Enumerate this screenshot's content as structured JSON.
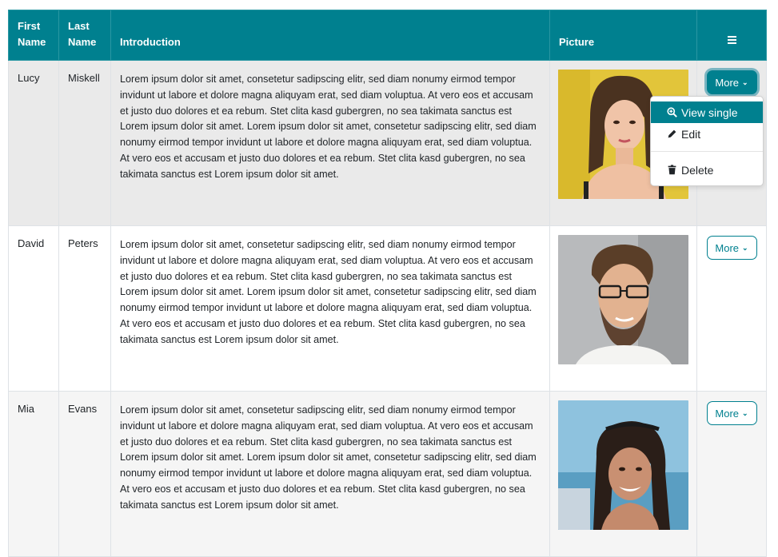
{
  "table": {
    "headers": {
      "first_name": "First Name",
      "last_name": "Last Name",
      "introduction": "Introduction",
      "picture": "Picture",
      "menu_icon": "hamburger-menu-icon"
    },
    "rows": [
      {
        "first_name": "Lucy",
        "last_name": "Miskell",
        "introduction": "Lorem ipsum dolor sit amet, consetetur sadipscing elitr, sed diam nonumy eirmod tempor invidunt ut labore et dolore magna aliquyam erat, sed diam voluptua. At vero eos et accusam et justo duo dolores et ea rebum. Stet clita kasd gubergren, no sea takimata sanctus est Lorem ipsum dolor sit amet. Lorem ipsum dolor sit amet, consetetur sadipscing elitr, sed diam nonumy eirmod tempor invidunt ut labore et dolore magna aliquyam erat, sed diam voluptua. At vero eos et accusam et justo duo dolores et ea rebum. Stet clita kasd gubergren, no sea takimata sanctus est Lorem ipsum dolor sit amet.",
        "picture": "woman-portrait-yellow-background",
        "more_label": "More"
      },
      {
        "first_name": "David",
        "last_name": "Peters",
        "introduction": "Lorem ipsum dolor sit amet, consetetur sadipscing elitr, sed diam nonumy eirmod tempor invidunt ut labore et dolore magna aliquyam erat, sed diam voluptua. At vero eos et accusam et justo duo dolores et ea rebum. Stet clita kasd gubergren, no sea takimata sanctus est Lorem ipsum dolor sit amet. Lorem ipsum dolor sit amet, consetetur sadipscing elitr, sed diam nonumy eirmod tempor invidunt ut labore et dolore magna aliquyam erat, sed diam voluptua. At vero eos et accusam et justo duo dolores et ea rebum. Stet clita kasd gubergren, no sea takimata sanctus est Lorem ipsum dolor sit amet.",
        "picture": "man-portrait-glasses",
        "more_label": "More"
      },
      {
        "first_name": "Mia",
        "last_name": "Evans",
        "introduction": "Lorem ipsum dolor sit amet, consetetur sadipscing elitr, sed diam nonumy eirmod tempor invidunt ut labore et dolore magna aliquyam erat, sed diam voluptua. At vero eos et accusam et justo duo dolores et ea rebum. Stet clita kasd gubergren, no sea takimata sanctus est Lorem ipsum dolor sit amet. Lorem ipsum dolor sit amet, consetetur sadipscing elitr, sed diam nonumy eirmod tempor invidunt ut labore et dolore magna aliquyam erat, sed diam voluptua. At vero eos et accusam et justo duo dolores et ea rebum. Stet clita kasd gubergren, no sea takimata sanctus est Lorem ipsum dolor sit amet.",
        "picture": "woman-portrait-sunglasses-on-head",
        "more_label": "More"
      }
    ]
  },
  "dropdown": {
    "items": [
      {
        "label": "View single",
        "icon": "zoom-in-icon",
        "active": true
      },
      {
        "label": "Edit",
        "icon": "pencil-icon"
      },
      {
        "label": "Delete",
        "icon": "trash-icon"
      }
    ]
  },
  "colors": {
    "header_bg": "#00808f",
    "accent": "#00808f",
    "highlight_row": "#eaeaea",
    "striped_row": "#f5f5f5"
  }
}
